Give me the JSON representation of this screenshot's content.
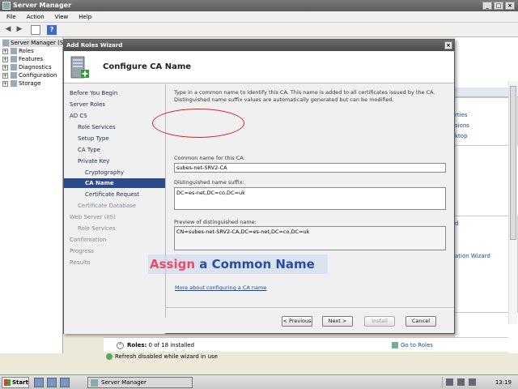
{
  "main_window": {
    "title": "Server Manager",
    "menu": [
      "File",
      "Action",
      "View",
      "Help"
    ],
    "tree": {
      "root": "Server Manager (S",
      "items": [
        "Roles",
        "Features",
        "Diagnostics",
        "Configuration",
        "Storage"
      ]
    },
    "right_pane_links": [
      "rties",
      "sions",
      "ktop",
      "d",
      "ation Wizard"
    ],
    "roles_summary": {
      "label": "Roles:",
      "count": "0 of 18 installed",
      "go_to_roles": "Go to Roles"
    },
    "status": "Refresh disabled while wizard in use"
  },
  "wizard": {
    "title": "Add Roles Wizard",
    "close": "×",
    "header_title": "Configure CA Name",
    "nav": [
      {
        "label": "Before You Begin",
        "level": 0,
        "state": "normal"
      },
      {
        "label": "Server Roles",
        "level": 0,
        "state": "normal"
      },
      {
        "label": "AD CS",
        "level": 0,
        "state": "normal"
      },
      {
        "label": "Role Services",
        "level": 1,
        "state": "normal"
      },
      {
        "label": "Setup Type",
        "level": 1,
        "state": "normal"
      },
      {
        "label": "CA Type",
        "level": 1,
        "state": "normal"
      },
      {
        "label": "Private Key",
        "level": 1,
        "state": "normal"
      },
      {
        "label": "Cryptography",
        "level": 2,
        "state": "normal"
      },
      {
        "label": "CA Name",
        "level": 2,
        "state": "active"
      },
      {
        "label": "Certificate Request",
        "level": 2,
        "state": "normal"
      },
      {
        "label": "Certificate Database",
        "level": 1,
        "state": "disabled"
      },
      {
        "label": "Web Server (IIS)",
        "level": 0,
        "state": "disabled"
      },
      {
        "label": "Role Services",
        "level": 1,
        "state": "disabled"
      },
      {
        "label": "Confirmation",
        "level": 0,
        "state": "disabled"
      },
      {
        "label": "Progress",
        "level": 0,
        "state": "disabled"
      },
      {
        "label": "Results",
        "level": 0,
        "state": "disabled"
      }
    ],
    "intro": "Type in a common name to identify this CA. This name is added to all certificates issued by the CA. Distinguished name suffix values are automatically generated but can be modified.",
    "common_name_label": "Common name for this CA:",
    "common_name_value": "subes-net-SRV2-CA",
    "dn_suffix_label": "Distinguished name suffix:",
    "dn_suffix_value": "DC=es-net,DC=co,DC=uk",
    "preview_label": "Preview of distinguished name:",
    "preview_value": "CN=subes-net-SRV2-CA,DC=es-net,DC=co,DC=uk",
    "more_link": "More about configuring a CA name",
    "buttons": {
      "previous": "< Previous",
      "next": "Next >",
      "install": "Install",
      "cancel": "Cancel"
    }
  },
  "caption": {
    "word1": "Assign",
    "rest": " a Common Name"
  },
  "taskbar": {
    "start": "Start",
    "task": "Server Manager",
    "clock": "13:19"
  }
}
